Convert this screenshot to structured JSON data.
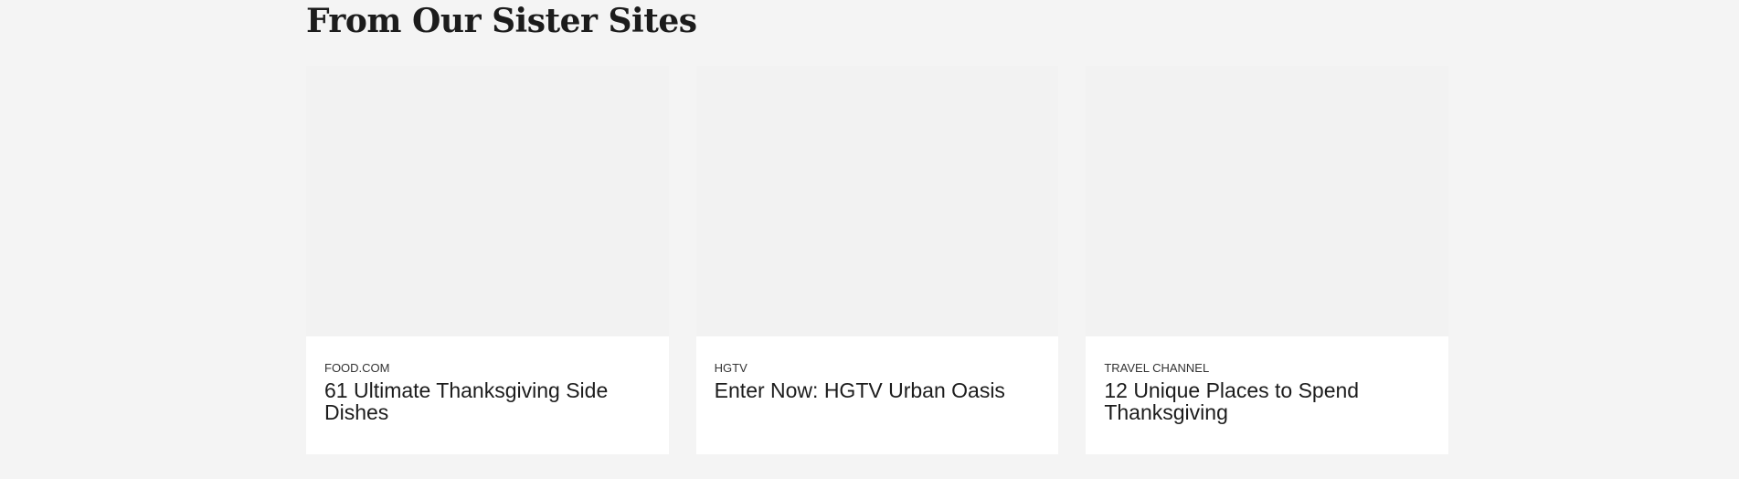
{
  "section": {
    "title": "From Our Sister Sites"
  },
  "cards": [
    {
      "brand": "FOOD.COM",
      "headline": "61 Ultimate Thanksgiving Side Dishes"
    },
    {
      "brand": "HGTV",
      "headline": "Enter Now: HGTV Urban Oasis"
    },
    {
      "brand": "TRAVEL CHANNEL",
      "headline": "12 Unique Places to Spend Thanksgiving"
    }
  ]
}
